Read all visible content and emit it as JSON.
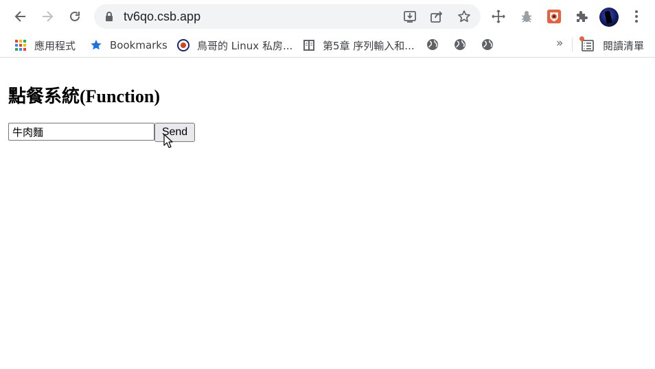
{
  "browser": {
    "url": "tv6qo.csb.app"
  },
  "bookmarks": {
    "items": [
      {
        "label": "應用程式",
        "icon": "apps-grid-icon"
      },
      {
        "label": "Bookmarks",
        "icon": "star-icon"
      },
      {
        "label": "鳥哥的 Linux 私房...",
        "icon": "site-favicon-icon"
      },
      {
        "label": "第5章 序列輸入和...",
        "icon": "book-icon"
      }
    ],
    "globe_icons": 3,
    "more_label": "»",
    "reading_list_label": "閱讀清單"
  },
  "page": {
    "title": "點餐系統(Function)",
    "input_value": "牛肉麵",
    "send_label": "Send"
  },
  "colors": {
    "accent_blue": "#1a73e8",
    "extension_orange": "#e8613c"
  }
}
